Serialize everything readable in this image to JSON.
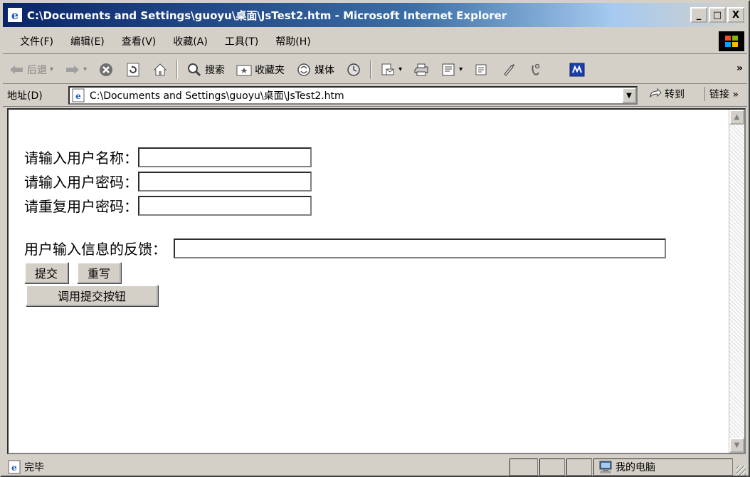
{
  "window": {
    "title": "C:\\Documents and Settings\\guoyu\\桌面\\JsTest2.htm - Microsoft Internet Explorer",
    "minimize": "_",
    "maximize": "□",
    "close": "X"
  },
  "menu": {
    "items": [
      "文件(F)",
      "编辑(E)",
      "查看(V)",
      "收藏(A)",
      "工具(T)",
      "帮助(H)"
    ]
  },
  "toolbar": {
    "back": "后退",
    "search": "搜索",
    "favorites": "收藏夹",
    "media": "媒体",
    "more": "»"
  },
  "address": {
    "label": "地址(D)",
    "value": "C:\\Documents and Settings\\guoyu\\桌面\\JsTest2.htm",
    "go": "转到",
    "links": "链接 »"
  },
  "form": {
    "username_label": "请输入用户名称：",
    "password_label": "请输入用户密码：",
    "repeat_label": "请重复用户密码：",
    "feedback_label": "用户输入信息的反馈：",
    "username_value": "",
    "password_value": "",
    "repeat_value": "",
    "feedback_value": "",
    "submit": "提交",
    "reset": "重写",
    "invoke_submit": "调用提交按钮"
  },
  "status": {
    "text": "完毕",
    "zone": "我的电脑"
  },
  "colors": {
    "title_start": "#0a246a",
    "title_end": "#a6caf0",
    "chrome": "#d4d0c8"
  }
}
